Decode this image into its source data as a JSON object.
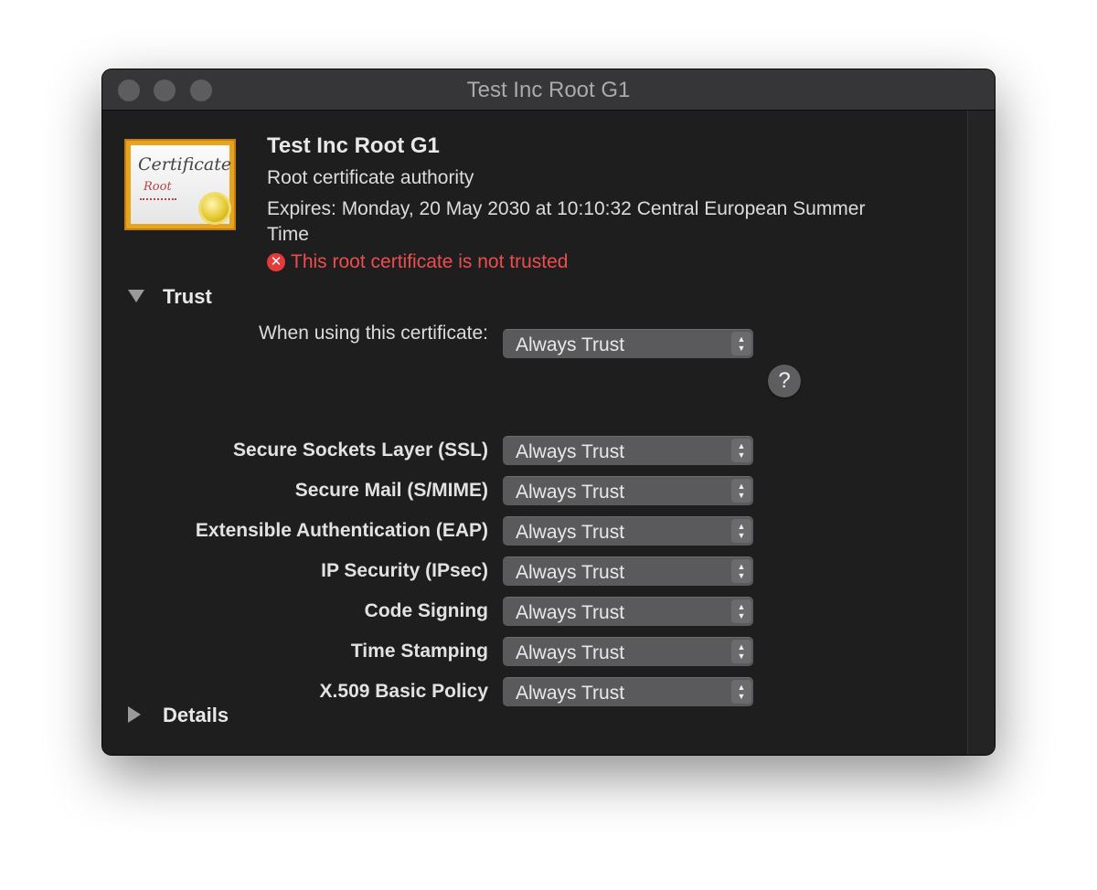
{
  "window": {
    "title": "Test Inc Root G1"
  },
  "certificate": {
    "icon_text": "Certificate",
    "icon_subtext": "Root",
    "name": "Test Inc Root G1",
    "kind": "Root certificate authority",
    "expiry": "Expires: Monday, 20 May 2030 at 10:10:32 Central European Summer Time",
    "status": "This root certificate is not trusted",
    "status_color": "#ee4d4d"
  },
  "trust": {
    "title": "Trust",
    "when_using_label": "When using this certificate:",
    "when_using_value": "Always Trust",
    "help_label": "?",
    "policies": [
      {
        "label": "Secure Sockets Layer (SSL)",
        "value": "Always Trust"
      },
      {
        "label": "Secure Mail (S/MIME)",
        "value": "Always Trust"
      },
      {
        "label": "Extensible Authentication (EAP)",
        "value": "Always Trust"
      },
      {
        "label": "IP Security (IPsec)",
        "value": "Always Trust"
      },
      {
        "label": "Code Signing",
        "value": "Always Trust"
      },
      {
        "label": "Time Stamping",
        "value": "Always Trust"
      },
      {
        "label": "X.509 Basic Policy",
        "value": "Always Trust"
      }
    ]
  },
  "details": {
    "title": "Details"
  },
  "icons": {
    "close": "close-icon",
    "error": "error-icon",
    "disclosure_open": "triangle-down-icon",
    "disclosure_closed": "triangle-right-icon",
    "stepper": "up-down-chevron-icon"
  }
}
